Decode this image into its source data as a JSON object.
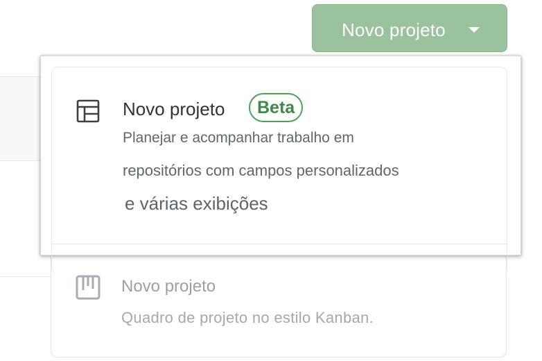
{
  "header": {
    "new_project_button_label": "Novo projeto"
  },
  "menu": {
    "items": [
      {
        "icon": "table-icon",
        "title": "Novo projeto",
        "badge": "Beta",
        "description_lines": [
          "Planejar e acompanhar trabalho em",
          "repositórios com campos personalizados",
          "e várias exibições"
        ]
      },
      {
        "icon": "kanban-board-icon",
        "title": "Novo projeto",
        "description": "Quadro de projeto no estilo Kanban."
      }
    ]
  },
  "colors": {
    "button_green": "#9ac29c",
    "badge_green": "#4ea15a",
    "text_dark": "#2f3337",
    "text_muted": "#a3a9ae"
  }
}
